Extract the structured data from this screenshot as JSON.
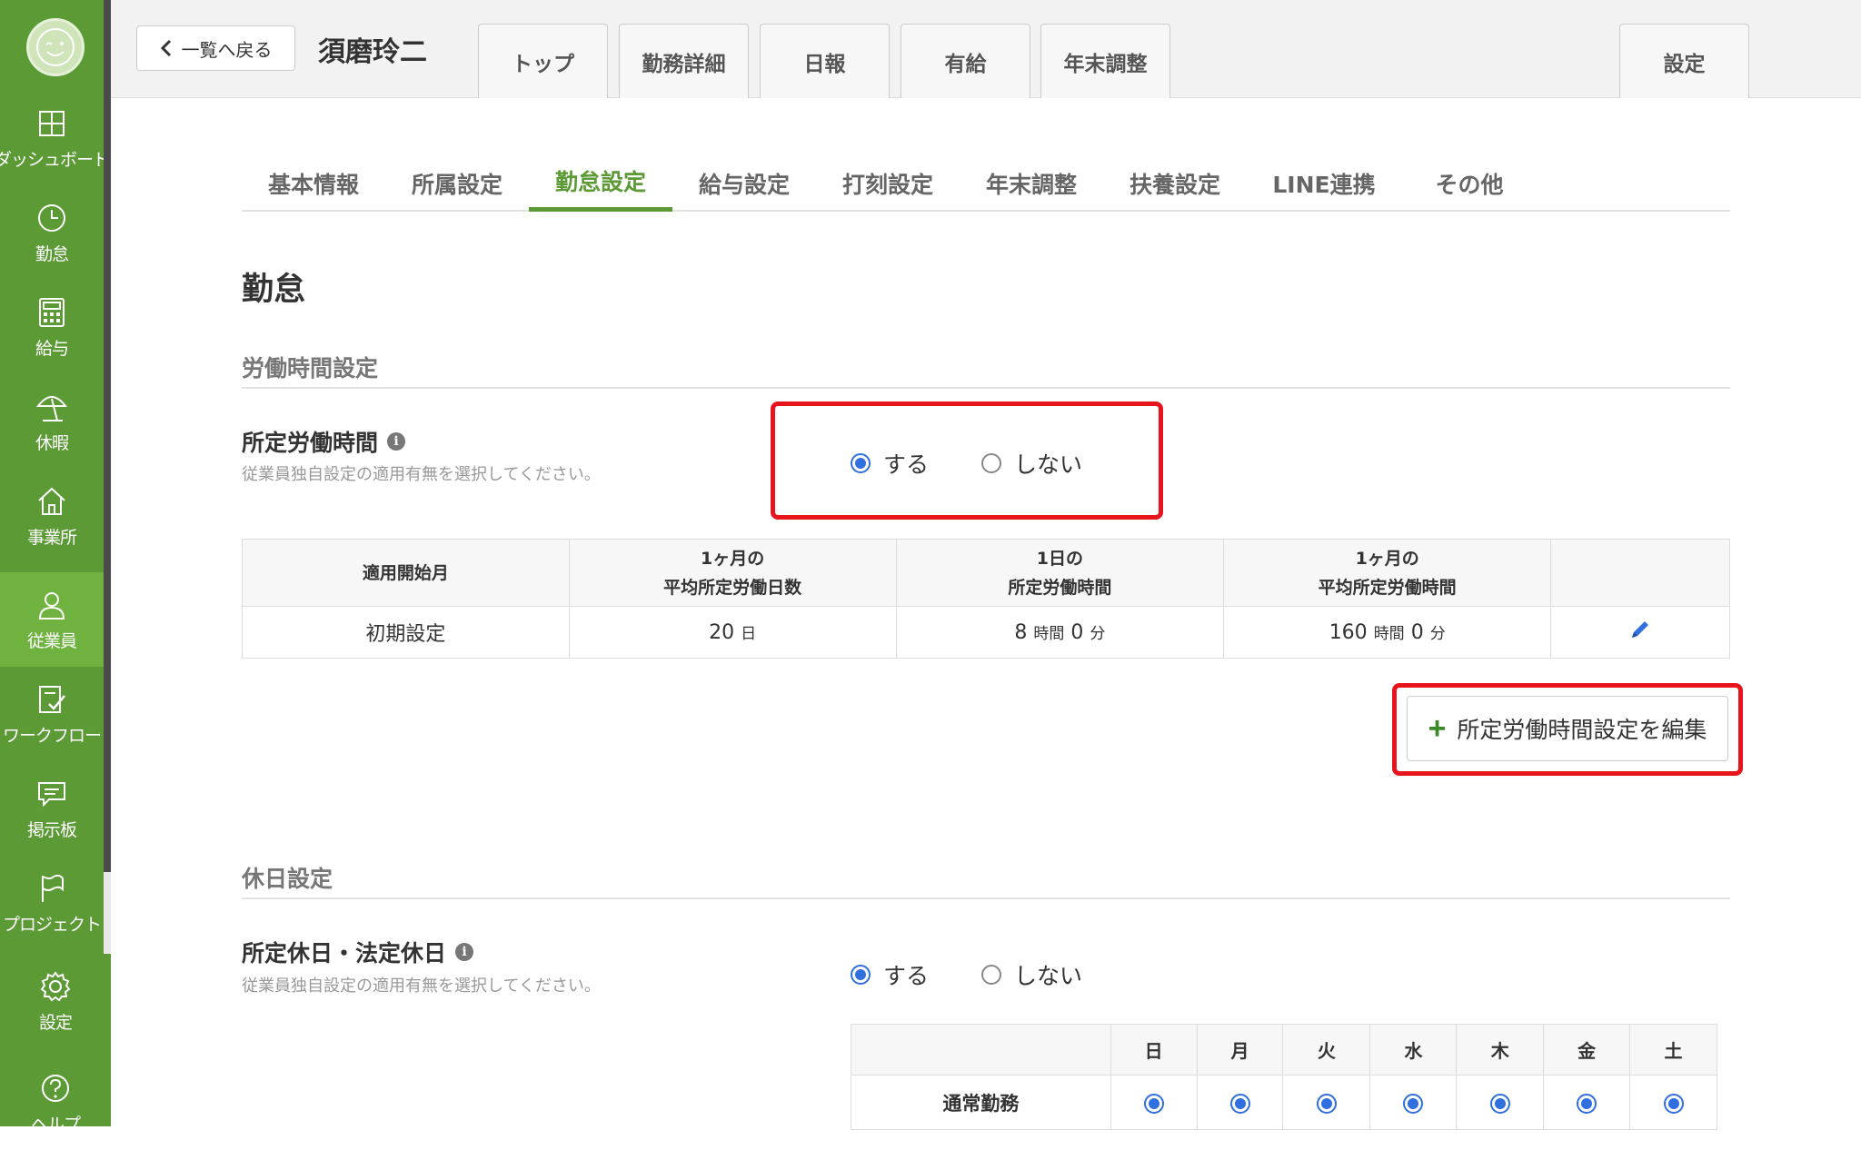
{
  "sidebar": {
    "items": [
      {
        "label": "ダッシュボード",
        "icon": "dashboard-icon"
      },
      {
        "label": "勤怠",
        "icon": "clock-icon"
      },
      {
        "label": "給与",
        "icon": "calculator-icon"
      },
      {
        "label": "休暇",
        "icon": "parasol-icon"
      },
      {
        "label": "事業所",
        "icon": "home-icon"
      },
      {
        "label": "従業員",
        "icon": "person-icon"
      },
      {
        "label": "ワークフロー",
        "icon": "checklist-icon"
      },
      {
        "label": "掲示板",
        "icon": "chat-icon"
      },
      {
        "label": "プロジェクト",
        "icon": "flag-icon"
      },
      {
        "label": "設定",
        "icon": "gear-icon"
      },
      {
        "label": "ヘルプ",
        "icon": "help-icon"
      }
    ],
    "active": "従業員"
  },
  "header": {
    "back_label": "一覧へ戻る",
    "employee_name": "須磨玲二",
    "tabs": [
      "トップ",
      "勤務詳細",
      "日報",
      "有給",
      "年末調整"
    ],
    "settings_tab": "設定"
  },
  "subtabs": {
    "items": [
      "基本情報",
      "所属設定",
      "勤怠設定",
      "給与設定",
      "打刻設定",
      "年末調整",
      "扶養設定",
      "LINE連携",
      "その他"
    ],
    "active": "勤怠設定"
  },
  "page_title": "勤怠",
  "work_hours": {
    "section_title": "労働時間設定",
    "field_label": "所定労働時間",
    "field_help": "従業員独自設定の適用有無を選択してください。",
    "option_yes": "する",
    "option_no": "しない",
    "selected": "する",
    "table": {
      "headers": {
        "start_month": "適用開始月",
        "avg_days_l1": "1ヶ月の",
        "avg_days_l2": "平均所定労働日数",
        "daily_l1": "1日の",
        "daily_l2": "所定労働時間",
        "avg_hours_l1": "1ヶ月の",
        "avg_hours_l2": "平均所定労働時間"
      },
      "row": {
        "start_month": "初期設定",
        "days": "20",
        "days_unit": "日",
        "daily_h": "8",
        "daily_h_unit": "時間",
        "daily_m": "0",
        "daily_m_unit": "分",
        "monthly_h": "160",
        "monthly_h_unit": "時間",
        "monthly_m": "0",
        "monthly_m_unit": "分"
      }
    },
    "edit_button": "所定労働時間設定を編集"
  },
  "holiday": {
    "section_title": "休日設定",
    "field_label": "所定休日・法定休日",
    "field_help": "従業員独自設定の適用有無を選択してください。",
    "option_yes": "する",
    "option_no": "しない",
    "selected": "する",
    "days": [
      "日",
      "月",
      "火",
      "水",
      "木",
      "金",
      "土"
    ],
    "row_label": "通常勤務"
  },
  "colors": {
    "sidebar": "#5c9a36",
    "accent": "#5c9a36",
    "highlight": "#e8141c",
    "radio": "#2f6fe0"
  }
}
